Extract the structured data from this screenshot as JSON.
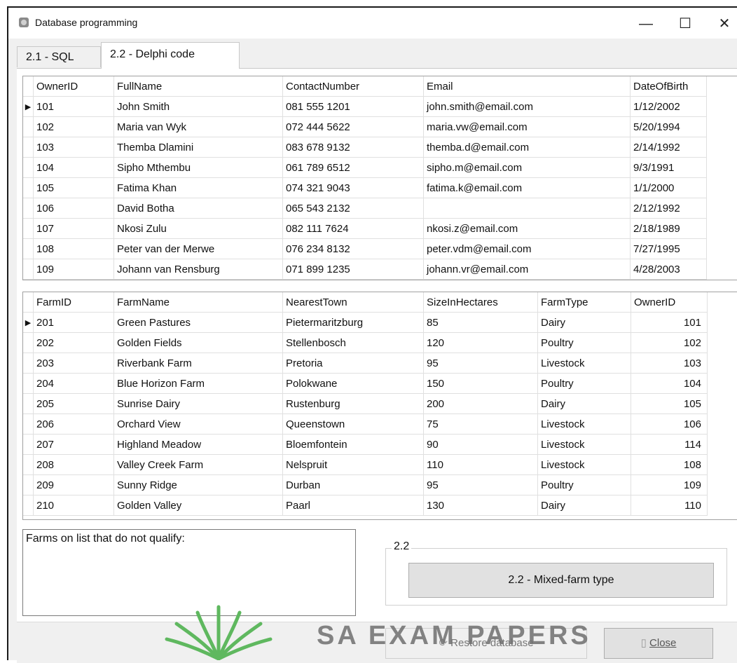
{
  "window": {
    "title": "Database programming",
    "minimize": "—",
    "maximize": "☐",
    "close": "✕"
  },
  "tabs": [
    {
      "label": "2.1 - SQL"
    },
    {
      "label": "2.2 - Delphi code"
    }
  ],
  "owners_grid": {
    "columns": [
      "OwnerID",
      "FullName",
      "ContactNumber",
      "Email",
      "DateOfBirth"
    ],
    "rows": [
      [
        "101",
        "John Smith",
        "081 555 1201",
        "john.smith@email.com",
        "1/12/2002"
      ],
      [
        "102",
        "Maria van Wyk",
        "072 444 5622",
        "maria.vw@email.com",
        "5/20/1994"
      ],
      [
        "103",
        "Themba Dlamini",
        "083 678 9132",
        "themba.d@email.com",
        "2/14/1992"
      ],
      [
        "104",
        "Sipho Mthembu",
        "061 789 6512",
        "sipho.m@email.com",
        "9/3/1991"
      ],
      [
        "105",
        "Fatima Khan",
        "074 321 9043",
        "fatima.k@email.com",
        "1/1/2000"
      ],
      [
        "106",
        "David Botha",
        "065 543 2132",
        "",
        "2/12/1992"
      ],
      [
        "107",
        "Nkosi Zulu",
        "082 111 7624",
        "nkosi.z@email.com",
        "2/18/1989"
      ],
      [
        "108",
        "Peter van der Merwe",
        "076 234 8132",
        "peter.vdm@email.com",
        "7/27/1995"
      ],
      [
        "109",
        "Johann van Rensburg",
        "071 899 1235",
        "johann.vr@email.com",
        "4/28/2003"
      ]
    ]
  },
  "farms_grid": {
    "columns": [
      "FarmID",
      "FarmName",
      "NearestTown",
      "SizeInHectares",
      "FarmType",
      "OwnerID"
    ],
    "rows": [
      [
        "201",
        "Green Pastures",
        "Pietermaritzburg",
        "85",
        "Dairy",
        "101"
      ],
      [
        "202",
        "Golden Fields",
        "Stellenbosch",
        "120",
        "Poultry",
        "102"
      ],
      [
        "203",
        "Riverbank Farm",
        "Pretoria",
        "95",
        "Livestock",
        "103"
      ],
      [
        "204",
        "Blue Horizon Farm",
        "Polokwane",
        "150",
        "Poultry",
        "104"
      ],
      [
        "205",
        "Sunrise Dairy",
        "Rustenburg",
        "200",
        "Dairy",
        "105"
      ],
      [
        "206",
        "Orchard View",
        "Queenstown",
        "75",
        "Livestock",
        "106"
      ],
      [
        "207",
        "Highland Meadow",
        "Bloemfontein",
        "90",
        "Livestock",
        "114"
      ],
      [
        "208",
        "Valley Creek Farm",
        "Nelspruit",
        "110",
        "Livestock",
        "108"
      ],
      [
        "209",
        "Sunny Ridge",
        "Durban",
        "95",
        "Poultry",
        "109"
      ],
      [
        "210",
        "Golden Valley",
        "Paarl",
        "130",
        "Dairy",
        "110"
      ]
    ]
  },
  "memo": {
    "text": "Farms on list that do not qualify:"
  },
  "groupbox": {
    "label": "2.2",
    "button_label": "2.2 - Mixed-farm type"
  },
  "bottom": {
    "restore_label": "Restore database",
    "close_label": "Close"
  },
  "watermark": {
    "text": "SA EXAM PAPERS"
  },
  "colors": {
    "window_bg": "#f0f0f0",
    "button_bg": "#e1e1e1",
    "watermark_green": "#4caf50"
  }
}
